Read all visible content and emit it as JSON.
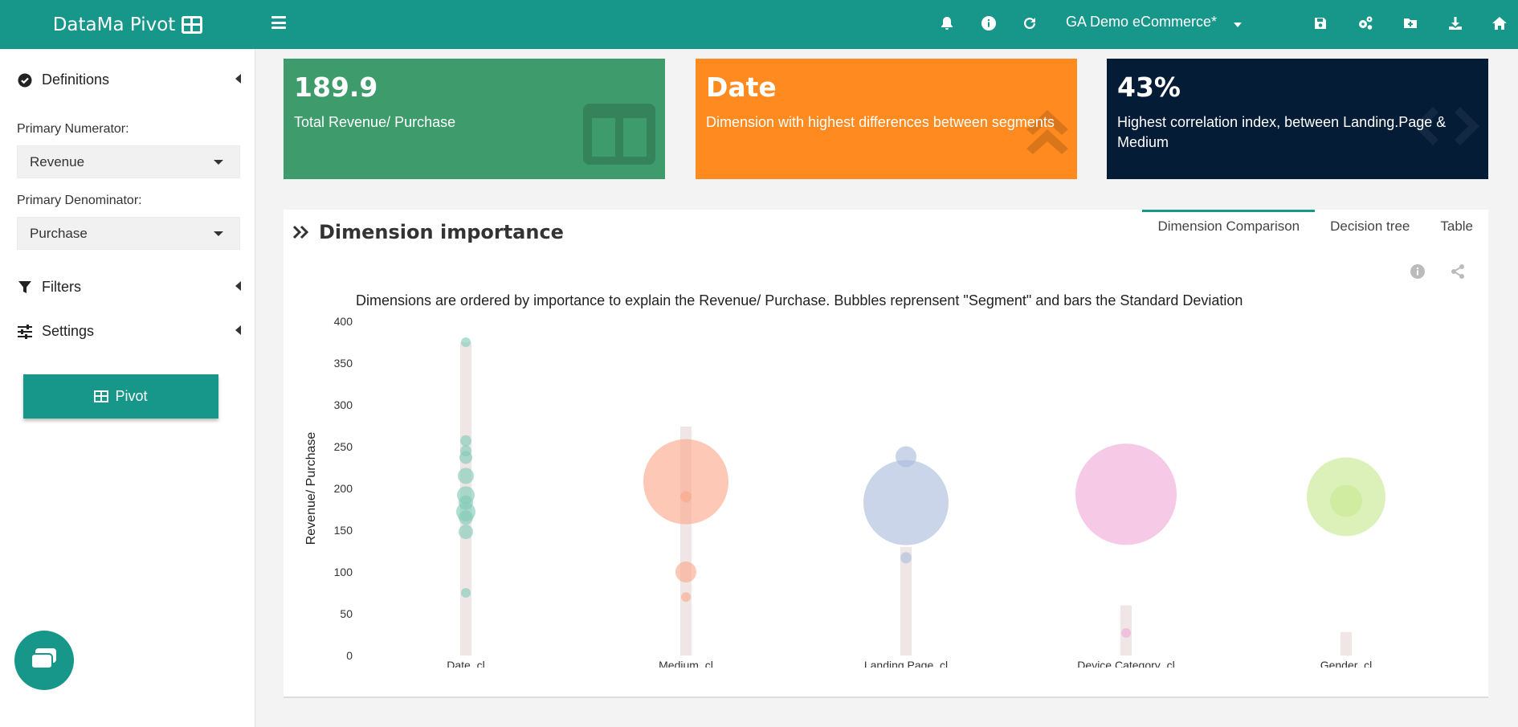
{
  "header": {
    "brand": "DataMa Pivot",
    "dataset": "GA Demo eCommerce*"
  },
  "sidebar": {
    "definitions_label": "Definitions",
    "primary_numerator_label": "Primary Numerator:",
    "primary_numerator_value": "Revenue",
    "primary_denominator_label": "Primary Denominator:",
    "primary_denominator_value": "Purchase",
    "filters_label": "Filters",
    "settings_label": "Settings",
    "pivot_button": "Pivot"
  },
  "kpis": [
    {
      "value": "189.9",
      "desc": "Total Revenue/ Purchase",
      "color": "#3e9b6b"
    },
    {
      "value": "Date",
      "desc": "Dimension with highest differences between segments",
      "color": "#ff8a1f"
    },
    {
      "value": "43%",
      "desc": "Highest correlation index, between Landing.Page & Medium",
      "color": "#041c36"
    }
  ],
  "card": {
    "title": "Dimension importance",
    "tabs": [
      "Dimension Comparison",
      "Decision tree",
      "Table"
    ],
    "active_tab": 0
  },
  "chart_data": {
    "type": "scatter",
    "title": "Dimensions are ordered by importance to explain the Revenue/ Purchase. Bubbles reprensent \"Segment\" and bars the Standard Deviation",
    "ylabel": "Revenue/ Purchase",
    "xlabel": "",
    "ylim": [
      0,
      400
    ],
    "yticks": [
      0,
      50,
      100,
      150,
      200,
      250,
      300,
      350,
      400
    ],
    "categories": [
      "Date_cl",
      "Medium_cl",
      "Landing.Page_cl",
      "Device.Category_cl",
      "Gender_cl"
    ],
    "std_bars": [
      {
        "category": "Date_cl",
        "low": 0,
        "high": 375
      },
      {
        "category": "Medium_cl",
        "low": 0,
        "high": 274
      },
      {
        "category": "Landing.Page_cl",
        "low": 0,
        "high": 130
      },
      {
        "category": "Device.Category_cl",
        "low": 0,
        "high": 60
      },
      {
        "category": "Gender_cl",
        "low": 0,
        "high": 28
      }
    ],
    "series": [
      {
        "category": "Date_cl",
        "color": "#7fcbb6",
        "points": [
          {
            "y": 375,
            "size": 6
          },
          {
            "y": 257,
            "size": 7
          },
          {
            "y": 245,
            "size": 7
          },
          {
            "y": 237,
            "size": 8
          },
          {
            "y": 215,
            "size": 10
          },
          {
            "y": 192,
            "size": 11
          },
          {
            "y": 183,
            "size": 9
          },
          {
            "y": 172,
            "size": 12
          },
          {
            "y": 165,
            "size": 9
          },
          {
            "y": 148,
            "size": 9
          },
          {
            "y": 75,
            "size": 6
          }
        ]
      },
      {
        "category": "Medium_cl",
        "color": "#fca689",
        "points": [
          {
            "y": 208,
            "size": 53
          },
          {
            "y": 190,
            "size": 7
          },
          {
            "y": 100,
            "size": 13
          },
          {
            "y": 70,
            "size": 6
          }
        ]
      },
      {
        "category": "Landing.Page_cl",
        "color": "#a9bcdb",
        "points": [
          {
            "y": 183,
            "size": 53
          },
          {
            "y": 238,
            "size": 13
          },
          {
            "y": 117,
            "size": 7
          }
        ]
      },
      {
        "category": "Device.Category_cl",
        "color": "#f0a8d6",
        "points": [
          {
            "y": 193,
            "size": 63
          },
          {
            "y": 27,
            "size": 6
          }
        ]
      },
      {
        "category": "Gender_cl",
        "color": "#c6e88f",
        "points": [
          {
            "y": 190,
            "size": 49
          },
          {
            "y": 185,
            "size": 20
          }
        ]
      }
    ]
  }
}
